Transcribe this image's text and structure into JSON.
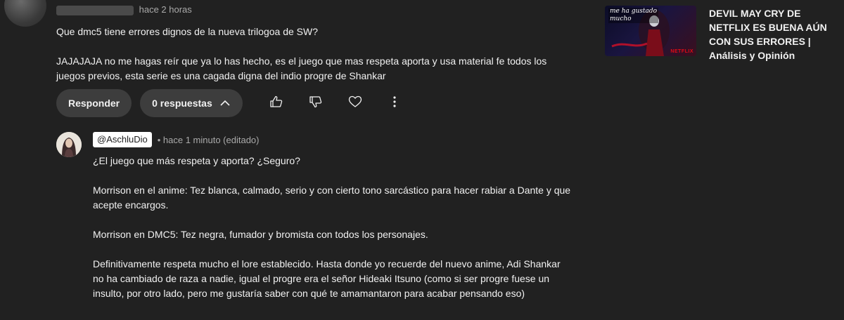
{
  "top_comment": {
    "meta_time": "hace 2 horas",
    "text": "Que dmc5 tiene errores dignos de la nueva trilogoa de SW?\n\nJAJAJAJA no me hagas reír que ya lo has hecho, es el juego que mas respeta aporta y usa material fe todos los juegos previos, esta serie es una cagada digna del indio progre de Shankar",
    "actions": {
      "reply_label": "Responder",
      "replies_label": "0 respuestas"
    }
  },
  "reply": {
    "handle": "@AschluDio",
    "meta": "• hace 1 minuto (editado)",
    "text": "¿El juego que más respeta y aporta? ¿Seguro?\n\nMorrison en el anime: Tez blanca, calmado, serio y con cierto tono sarcástico para hacer rabiar a Dante y que acepte encargos.\n\nMorrison en DMC5: Tez negra, fumador y bromista con todos los personajes.\n\nDefinitivamente respeta mucho el lore establecido. Hasta donde yo recuerde del nuevo anime, Adi Shankar no ha cambiado de raza a nadie, igual el progre era el señor Hideaki Itsuno (como si ser progre fuese un insulto, por otro lado, pero me gustaría saber con qué te amamantaron para acabar pensando eso)"
  },
  "recommendation": {
    "title": "DEVIL MAY CRY DE NETFLIX ES BUENA AÚN CON SUS ERRORES | Análisis y Opinión",
    "thumb_caption": "me ha gustado\nmucho",
    "thumb_brand": "NETFLIX"
  },
  "icons": [
    "thumb-up-icon",
    "thumb-down-icon",
    "heart-icon",
    "more-vert-icon",
    "chevron-up-icon"
  ]
}
